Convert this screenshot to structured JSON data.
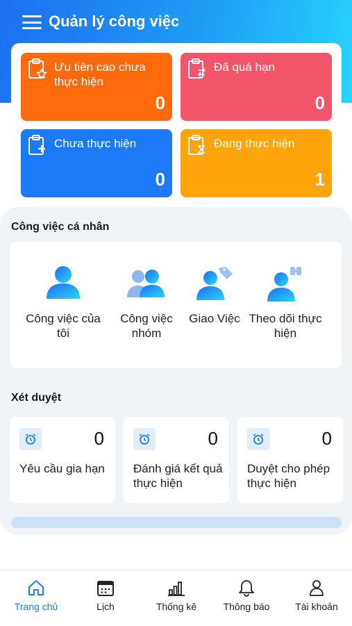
{
  "header": {
    "title": "Quản lý công việc"
  },
  "stats": [
    {
      "label": "Ưu tiên cao chưa thực hiện",
      "count": "0",
      "color": "#ff6a0d"
    },
    {
      "label": "Đã quá hạn",
      "count": "0",
      "color": "#f2556a"
    },
    {
      "label": "Chưa thực hiện",
      "count": "0",
      "color": "#1d7af6"
    },
    {
      "label": "Đang thực hiện",
      "count": "1",
      "color": "#ffa40d"
    }
  ],
  "personal": {
    "title": "Công việc cá nhân",
    "items": [
      {
        "label": "Công việc của tôi",
        "icon": "single-user-icon"
      },
      {
        "label": "Công việc nhóm",
        "icon": "group-users-icon"
      },
      {
        "label": "Giao Việc",
        "icon": "user-tag-icon"
      },
      {
        "label": "Theo dõi thực hiện",
        "icon": "user-binoculars-icon"
      }
    ]
  },
  "approval": {
    "title": "Xét duyệt",
    "items": [
      {
        "label": "Yêu cầu gia hạn",
        "count": "0",
        "icon": "alarm-clock-icon"
      },
      {
        "label": "Đánh giá kết quả thực hiện",
        "count": "0",
        "icon": "alarm-clock-icon"
      },
      {
        "label": "Duyệt cho phép thực hiện",
        "count": "0",
        "icon": "alarm-clock-icon"
      }
    ]
  },
  "nav": [
    {
      "label": "Trang chủ",
      "icon": "home-icon",
      "active": true
    },
    {
      "label": "Lịch",
      "icon": "calendar-icon",
      "active": false
    },
    {
      "label": "Thống kê",
      "icon": "bar-chart-icon",
      "active": false
    },
    {
      "label": "Thông báo",
      "icon": "bell-icon",
      "active": false
    },
    {
      "label": "Tài khoản",
      "icon": "user-icon",
      "active": false
    }
  ],
  "colors": {
    "accent": "#1d7af6",
    "header_start": "#1d6ff0",
    "header_end": "#27d4fb"
  }
}
